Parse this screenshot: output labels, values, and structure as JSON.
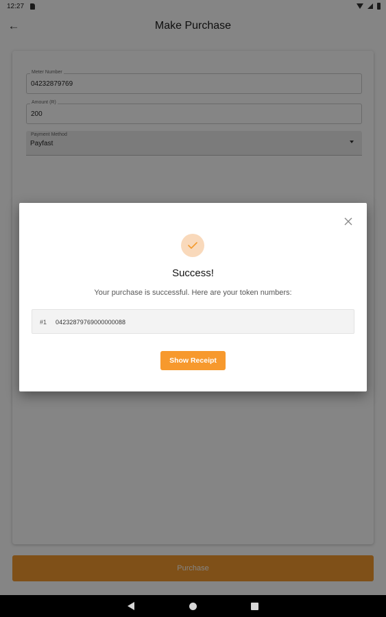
{
  "status_bar": {
    "time": "12:27",
    "icons": [
      "sd-card-icon",
      "wifi-icon",
      "signal-icon",
      "battery-icon"
    ]
  },
  "app_bar": {
    "title": "Make Purchase",
    "back_icon": "arrow-left-icon"
  },
  "form": {
    "meter_number": {
      "label": "Meter Number",
      "value": "04232879769"
    },
    "amount": {
      "label": "Amount (R)",
      "value": "200"
    },
    "payment_method": {
      "label": "Payment Method",
      "value": "Payfast"
    }
  },
  "purchase_button": {
    "label": "Purchase"
  },
  "dialog": {
    "title": "Success!",
    "message": "Your purchase is successful. Here are your token numbers:",
    "tokens": [
      {
        "index": "#1",
        "number": "04232879769000000088"
      }
    ],
    "show_receipt_label": "Show Receipt"
  },
  "colors": {
    "accent": "#f7992d",
    "success_badge_bg": "#f9d9bb",
    "scrim": "#000000"
  }
}
